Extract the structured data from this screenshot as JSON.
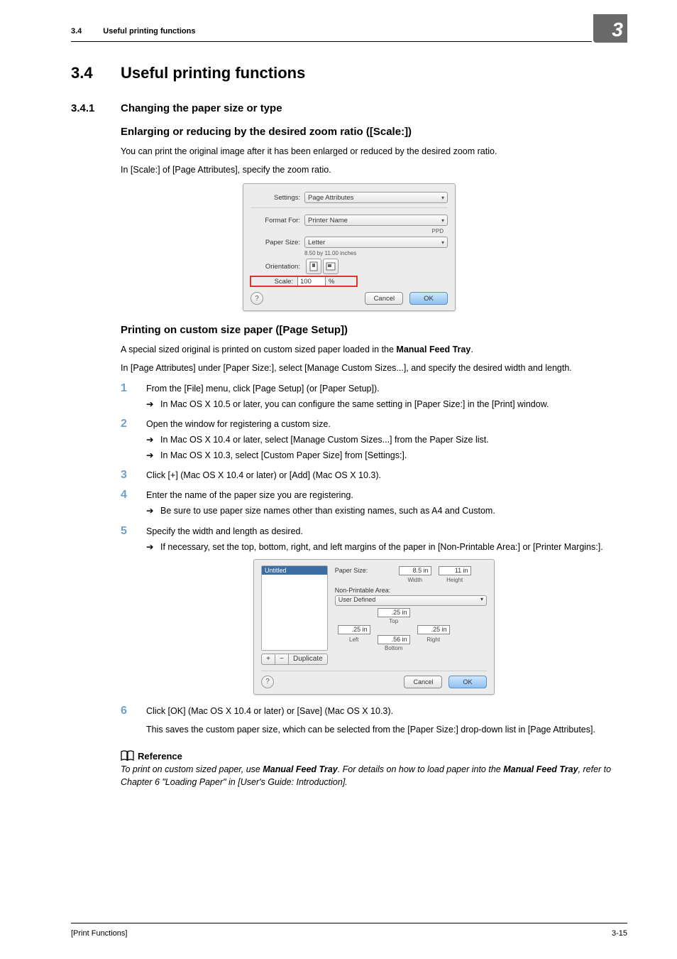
{
  "header": {
    "section_number": "3.4",
    "section_title": "Useful printing functions",
    "chapter_number": "3"
  },
  "h1": {
    "num": "3.4",
    "title": "Useful printing functions"
  },
  "h2_1": {
    "num": "3.4.1",
    "title": "Changing the paper size or type"
  },
  "scale": {
    "heading": "Enlarging or reducing by the desired zoom ratio ([Scale:])",
    "p1": "You can print the original image after it has been enlarged or reduced by the desired zoom ratio.",
    "p2": "In [Scale:] of [Page Attributes], specify the zoom ratio."
  },
  "dialog1": {
    "settings_label": "Settings:",
    "settings_value": "Page Attributes",
    "format_for_label": "Format For:",
    "format_for_value": "Printer Name",
    "format_for_sub": "PPD",
    "paper_size_label": "Paper Size:",
    "paper_size_value": "Letter",
    "paper_size_sub": "8.50 by 11.00 inches",
    "orientation_label": "Orientation:",
    "scale_label": "Scale:",
    "scale_value": "100",
    "scale_unit": "%",
    "help": "?",
    "cancel": "Cancel",
    "ok": "OK"
  },
  "custom": {
    "heading": "Printing on custom size paper ([Page Setup])",
    "p1_a": "A special sized original is printed on custom sized paper loaded in the ",
    "p1_b": "Manual Feed Tray",
    "p1_c": ".",
    "p2": "In [Page Attributes] under [Paper Size:], select [Manage Custom Sizes...], and specify the desired width and length.",
    "steps": [
      {
        "n": "1",
        "t": "From the [File] menu, click [Page Setup] (or [Paper Setup]).",
        "subs": [
          "In Mac OS X 10.5 or later, you can configure the same setting in [Paper Size:] in the [Print] window."
        ]
      },
      {
        "n": "2",
        "t": "Open the window for registering a custom size.",
        "subs": [
          "In Mac OS X 10.4 or later, select [Manage Custom Sizes...] from the Paper Size list.",
          "In Mac OS X 10.3, select [Custom Paper Size] from [Settings:]."
        ]
      },
      {
        "n": "3",
        "t": "Click [+] (Mac OS X 10.4 or later) or [Add] (Mac OS X 10.3).",
        "subs": []
      },
      {
        "n": "4",
        "t": "Enter the name of the paper size you are registering.",
        "subs": [
          "Be sure to use paper size names other than existing names, such as A4 and Custom."
        ]
      },
      {
        "n": "5",
        "t": "Specify the width and length as desired.",
        "subs": [
          "If necessary, set the top, bottom, right, and left margins of the paper in [Non-Printable Area:] or [Printer Margins:]."
        ]
      },
      {
        "n": "6",
        "t": "Click [OK] (Mac OS X 10.4 or later) or [Save] (Mac OS X 10.3).",
        "after": "This saves the custom paper size, which can be selected from the [Paper Size:] drop-down list in [Page Attributes].",
        "subs": []
      }
    ]
  },
  "dialog2": {
    "item": "Untitled",
    "plus": "+",
    "minus": "−",
    "duplicate": "Duplicate",
    "paper_size_label": "Paper Size:",
    "width_value": "8.5 in",
    "height_value": "11 in",
    "width_label": "Width",
    "height_label": "Height",
    "npa_label": "Non-Printable Area:",
    "npa_combo": "User Defined",
    "top_value": ".25 in",
    "top_label": "Top",
    "left_value": ".25 in",
    "left_label": "Left",
    "right_value": ".25 in",
    "right_label": "Right",
    "bottom_value": ".56 in",
    "bottom_label": "Bottom",
    "help": "?",
    "cancel": "Cancel",
    "ok": "OK"
  },
  "reference": {
    "title": "Reference",
    "p_a": "To print on custom sized paper, use ",
    "p_b": "Manual Feed Tray",
    "p_c": ". For details on how to load paper into the ",
    "p_d": "Manual Feed Tray",
    "p_e": ", refer to Chapter 6 \"Loading Paper\" in [User's Guide: Introduction]."
  },
  "footer": {
    "left": "[Print Functions]",
    "right": "3-15"
  }
}
